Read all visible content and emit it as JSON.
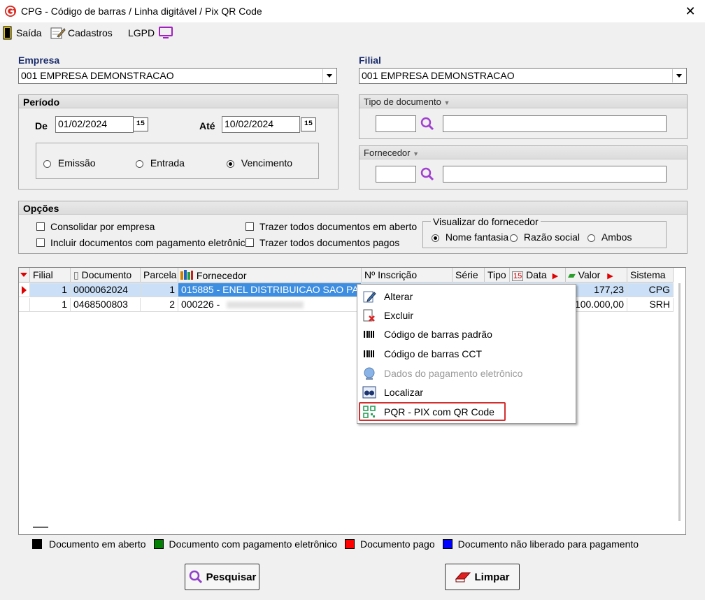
{
  "window": {
    "title": "CPG - Código de barras / Linha digitável / Pix QR Code"
  },
  "toolbar": {
    "exit": "Saída",
    "registers": "Cadastros",
    "lgpd": "LGPD"
  },
  "empresa": {
    "label": "Empresa",
    "value": "001 EMPRESA DEMONSTRACAO"
  },
  "filial": {
    "label": "Filial",
    "value": "001 EMPRESA DEMONSTRACAO"
  },
  "periodo": {
    "title": "Período",
    "from_label": "De",
    "from_value": "01/02/2024",
    "to_label": "Até",
    "to_value": "10/02/2024",
    "cal_icon": "15",
    "options": [
      "Emissão",
      "Entrada",
      "Vencimento"
    ],
    "selected": "Vencimento"
  },
  "tipo_documento": {
    "label": "Tipo de documento",
    "code": "",
    "name": ""
  },
  "fornecedor": {
    "label": "Fornecedor",
    "code": "",
    "name": ""
  },
  "opcoes": {
    "title": "Opções",
    "checks": [
      "Consolidar por empresa",
      "Incluir documentos com pagamento eletrônico",
      "Trazer todos documentos em aberto",
      "Trazer todos documentos pagos"
    ],
    "view_title": "Visualizar do fornecedor",
    "view_options": [
      "Nome fantasia",
      "Razão social",
      "Ambos"
    ],
    "view_selected": "Nome fantasia"
  },
  "grid": {
    "columns": [
      "Filial",
      "Documento",
      "Parcela",
      "Fornecedor",
      "Nº Inscrição",
      "Série",
      "Tipo",
      "Data",
      "Valor",
      "Sistema"
    ],
    "rows": [
      {
        "filial": "1",
        "documento": "0000062024",
        "parcela": "1",
        "fornecedor": "015885 - ENEL DISTRIBUICAO SAO PA...",
        "valor": "177,23",
        "sistema": "CPG"
      },
      {
        "filial": "1",
        "documento": "0468500803",
        "parcela": "2",
        "fornecedor": "000226 -",
        "valor": "100.000,00",
        "sistema": "SRH"
      }
    ]
  },
  "context_menu": {
    "items": [
      {
        "label": "Alterar",
        "icon": "edit-icon"
      },
      {
        "label": "Excluir",
        "icon": "delete-icon"
      },
      {
        "label": "Código de barras padrão",
        "icon": "barcode-icon"
      },
      {
        "label": "Código de barras CCT",
        "icon": "barcode-icon"
      },
      {
        "label": "Dados do pagamento eletrônico",
        "icon": "globe-icon",
        "disabled": true
      },
      {
        "label": "Localizar",
        "icon": "binoculars-icon"
      },
      {
        "label": "PQR - PIX com QR Code",
        "icon": "qr-icon",
        "highlighted": true
      }
    ]
  },
  "legend": [
    {
      "label": "Documento em aberto",
      "color": "#000000"
    },
    {
      "label": "Documento com pagamento eletrônico",
      "color": "#008000"
    },
    {
      "label": "Documento pago",
      "color": "#ff0000"
    },
    {
      "label": "Documento não liberado para pagamento",
      "color": "#0000ff"
    }
  ],
  "buttons": {
    "search": "Pesquisar",
    "clear": "Limpar"
  }
}
